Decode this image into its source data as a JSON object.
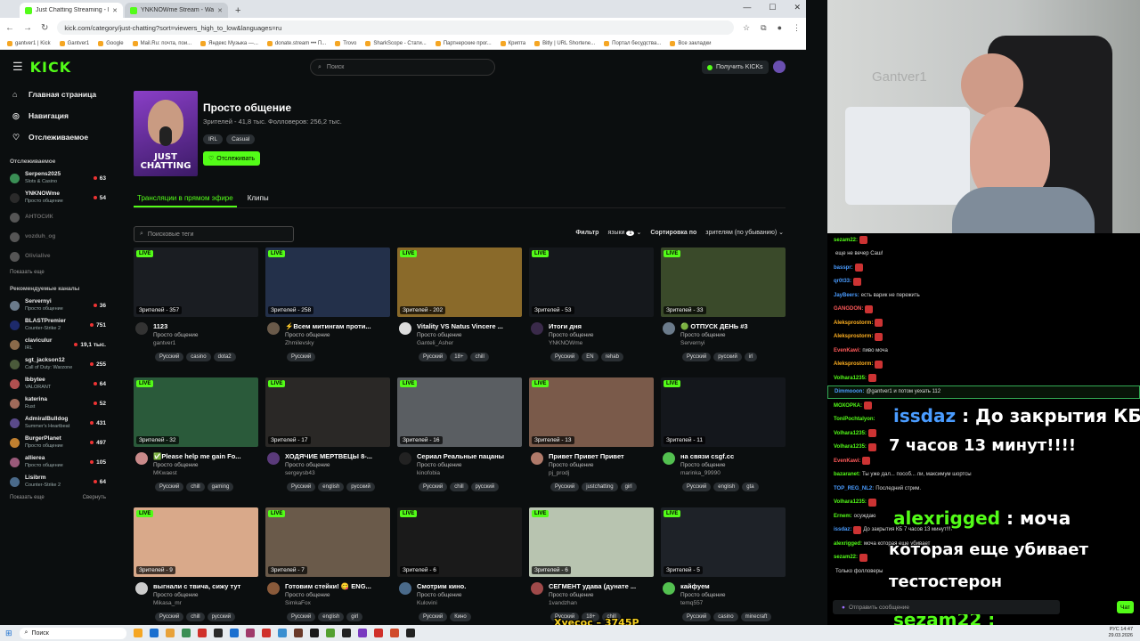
{
  "browser": {
    "tabs": [
      {
        "label": "Just Chatting Streaming - Live"
      },
      {
        "label": "YNKNOWme Stream - Watch Li..."
      }
    ],
    "url": "kick.com/category/just-chatting?sort=viewers_high_to_low&languages=ru",
    "bookmarks": [
      "gantver1 | Kick",
      "Gantver1",
      "Google",
      "Mail.Ru: почта, пои...",
      "Яндекс Музыка —...",
      "donate.stream ••• П...",
      "Trovo",
      "SharkScope - Стати...",
      "Партнерские прог...",
      "Крипта",
      "Bitly | URL Shortene...",
      "Портал бесудства...",
      "Все закладки"
    ]
  },
  "kick": {
    "logo": "KICK",
    "search_placeholder": "Поиск",
    "get_kicks": "Получить KICKs",
    "nav": [
      {
        "label": "Главная страница",
        "icon": "home-icon"
      },
      {
        "label": "Навигация",
        "icon": "compass-icon"
      },
      {
        "label": "Отслеживаемое",
        "icon": "heart-icon"
      }
    ],
    "following_header": "Отслеживаемое",
    "following": [
      {
        "name": "Serpens2025",
        "cat": "Slots & Casino",
        "count": "63",
        "color": "#3a8f55",
        "offline": false
      },
      {
        "name": "YNKNOWme",
        "cat": "Просто общение",
        "count": "54",
        "color": "#2a2a2a",
        "offline": false
      },
      {
        "name": "АНТОСИК",
        "cat": "",
        "count": "",
        "color": "#555",
        "offline": true
      },
      {
        "name": "vozduh_og",
        "cat": "",
        "count": "",
        "color": "#555",
        "offline": true
      },
      {
        "name": "Olivialive",
        "cat": "",
        "count": "",
        "color": "#555",
        "offline": true
      }
    ],
    "show_more": "Показать еще",
    "recommended_header": "Рекомендуемые каналы",
    "recommended": [
      {
        "name": "Servernyi",
        "cat": "Просто общение",
        "count": "36",
        "color": "#6b7b8b"
      },
      {
        "name": "BLASTPremier",
        "cat": "Counter-Strike 2",
        "count": "751",
        "color": "#1d2a6b"
      },
      {
        "name": "claviculur",
        "cat": "IRL",
        "count": "19,1 тыс.",
        "color": "#8a6a4a"
      },
      {
        "name": "sgt_jackson12",
        "cat": "Call of Duty: Warzone",
        "count": "255",
        "color": "#4a5a3a"
      },
      {
        "name": "Ibbytee",
        "cat": "VALORANT",
        "count": "64",
        "color": "#b05050"
      },
      {
        "name": "katerina",
        "cat": "Rust",
        "count": "52",
        "color": "#a06a5a"
      },
      {
        "name": "AdmiralBulldog",
        "cat": "Summer's Heartbeat",
        "count": "431",
        "color": "#5a4a8a"
      },
      {
        "name": "BurgerPlanet",
        "cat": "Просто общение",
        "count": "497",
        "color": "#c08030"
      },
      {
        "name": "allierea",
        "cat": "Просто общение",
        "count": "105",
        "color": "#9a5a7a"
      },
      {
        "name": "Lisibrm",
        "cat": "Counter-Strike 2",
        "count": "64",
        "color": "#4a6a8a"
      }
    ],
    "show_more2": "Показать еще",
    "collapse": "Свернуть",
    "category": {
      "title": "Просто общение",
      "stats": "Зрителей - 41,8 тыс.  Фолловеров: 256,2 тыс.",
      "tags": [
        "IRL",
        "Casual"
      ],
      "follow": "Отслеживать",
      "image_text": "JUST CHATTING"
    },
    "tabs": [
      "Трансляции в прямом эфире",
      "Клипы"
    ],
    "tag_search_placeholder": "Поисковые теги",
    "filter_label": "Фильтр",
    "languages_label": "языки",
    "languages_count": "1",
    "sort_label": "Сортировка по",
    "sort_value": "зрителям (по убыванию)",
    "live_label": "LIVE",
    "streams": [
      {
        "viewers": "Зрителей - 357",
        "title": "1123",
        "cat": "Просто общение",
        "user": "gantver1",
        "tags": [
          "Русский",
          "casino",
          "dota2"
        ],
        "bg": "#1a1d22",
        "av": "#333"
      },
      {
        "viewers": "Зрителей - 258",
        "title": "⚡Всем митингам проти...",
        "cat": "Просто общение",
        "user": "Zhmilevsky",
        "tags": [
          "Русский"
        ],
        "bg": "#23304a",
        "av": "#6a5a4a"
      },
      {
        "viewers": "Зрителей - 202",
        "title": "Vitality VS Natus Vincere ...",
        "cat": "Просто общение",
        "user": "Ganteli_Asher",
        "tags": [
          "Русский",
          "18+",
          "chill"
        ],
        "bg": "#8a6a2a",
        "av": "#ddd"
      },
      {
        "viewers": "Зрителей - 53",
        "title": "Итоги дня",
        "cat": "Просто общение",
        "user": "YNKNOWme",
        "tags": [
          "Русский",
          "EN",
          "rehab"
        ],
        "bg": "#15181c",
        "av": "#3a2a4a"
      },
      {
        "viewers": "Зрителей - 33",
        "title": "🟢 ОТПУСК ДЕНЬ #3",
        "cat": "Просто общение",
        "user": "Servernyi",
        "tags": [
          "Русский",
          "русский",
          "irl"
        ],
        "bg": "#3a4a2a",
        "av": "#6b7b8b"
      },
      {
        "viewers": "Зрителей - 32",
        "title": "✅Please help me gain Fo...",
        "cat": "Просто общение",
        "user": "MKwaest",
        "tags": [
          "Русский",
          "chill",
          "gaming"
        ],
        "bg": "#2a5a3a",
        "av": "#c98a8a"
      },
      {
        "viewers": "Зрителей - 17",
        "title": "ХОДЯЧИЕ МЕРТВЕЦЫ 8-...",
        "cat": "Просто общение",
        "user": "sergeysb43",
        "tags": [
          "Русский",
          "english",
          "русский"
        ],
        "bg": "#2a2826",
        "av": "#5a3a7a"
      },
      {
        "viewers": "Зрителей - 16",
        "title": "Сериал Реальные пацаны",
        "cat": "Просто общение",
        "user": "kinofobia",
        "tags": [
          "Русский",
          "chill",
          "русский"
        ],
        "bg": "#5a5e62",
        "av": "#222"
      },
      {
        "viewers": "Зрителей - 13",
        "title": "Привет Привет Привет",
        "cat": "Просто общение",
        "user": "pj_prodj",
        "tags": [
          "Русский",
          "justchatting",
          "girl"
        ],
        "bg": "#7a5a4a",
        "av": "#b07a6a"
      },
      {
        "viewers": "Зрителей - 11",
        "title": "на связи csgf.cc",
        "cat": "Просто общение",
        "user": "marinka_99990",
        "tags": [
          "Русский",
          "english",
          "gta"
        ],
        "bg": "#14171c",
        "av": "#53c050"
      },
      {
        "viewers": "Зрителей - 9",
        "title": "выгнали с твича, сижу тут",
        "cat": "Просто общение",
        "user": "Mikasa_mr",
        "tags": [
          "Русский",
          "chill",
          "русский"
        ],
        "bg": "#d9a98a",
        "av": "#ccc"
      },
      {
        "viewers": "Зрителей - 7",
        "title": "Готовим стейки! 😋 ENG...",
        "cat": "Просто общение",
        "user": "SimkaFox",
        "tags": [
          "Русский",
          "english",
          "girl"
        ],
        "bg": "#6a5a4a",
        "av": "#8a5a3a"
      },
      {
        "viewers": "Зрителей - 6",
        "title": "Смотрим кино.",
        "cat": "Просто общение",
        "user": "Kulovini",
        "tags": [
          "Русский",
          "Кино"
        ],
        "bg": "#1a1a1a",
        "av": "#4a6a8a"
      },
      {
        "viewers": "Зрителей - 6",
        "title": "СЕГМЕНТ удава (дунате ...",
        "cat": "Просто общение",
        "user": "1vandzhan",
        "tags": [
          "Русский",
          "18+",
          "chill"
        ],
        "bg": "#b8c4b0",
        "av": "#a04a4a"
      },
      {
        "viewers": "Зрителей - 5",
        "title": "кайфуем",
        "cat": "Просто общение",
        "user": "temq557",
        "tags": [
          "Русский",
          "casino",
          "minecraft"
        ],
        "bg": "#1e2228",
        "av": "#53c050"
      }
    ]
  },
  "stream": {
    "watermark": "Gantver1"
  },
  "chat": {
    "messages": [
      {
        "user": "sezam22:",
        "color": "#53fc18",
        "text": "",
        "emote": true
      },
      {
        "user": "",
        "color": "#53fc18",
        "text": "еще не вечер Саш!",
        "emote": false
      },
      {
        "user": "basspr:",
        "color": "#4a9cff",
        "text": "",
        "emote": true
      },
      {
        "user": "qr0t33:",
        "color": "#4a9cff",
        "text": "",
        "emote": true
      },
      {
        "user": "JayBeers:",
        "color": "#4a9cff",
        "text": "есть варик не пережить",
        "emote": false
      },
      {
        "user": "GANGDON:",
        "color": "#ff5a5a",
        "text": "",
        "emote": true
      },
      {
        "user": "Aleksprostorm:",
        "color": "#ffb020",
        "text": "",
        "emote": true
      },
      {
        "user": "Aleksprostorm:",
        "color": "#ffb020",
        "text": "",
        "emote": true
      },
      {
        "user": "EvenKawi:",
        "color": "#ff5a5a",
        "text": "пиво мочa",
        "emote": false
      },
      {
        "user": "Aleksprostorm:",
        "color": "#ffb020",
        "text": "",
        "emote": true
      },
      {
        "user": "Volhara1235:",
        "color": "#53fc18",
        "text": "",
        "emote": true
      },
      {
        "user": "Dimmooon:",
        "color": "#4a9cff",
        "text": "@gantver1 и потом уехать 112",
        "emote": false,
        "hl": true
      },
      {
        "user": "МОХОРКА:",
        "color": "#53fc18",
        "text": "",
        "emote": true
      },
      {
        "user": "ToniPochtalyon:",
        "color": "#53fc18",
        "text": "",
        "emote": false
      },
      {
        "user": "Volhara1235:",
        "color": "#53fc18",
        "text": "",
        "emote": true
      },
      {
        "user": "Volhara1235:",
        "color": "#53fc18",
        "text": "",
        "emote": true
      },
      {
        "user": "EvenKawi:",
        "color": "#ff5a5a",
        "text": "",
        "emote": true
      },
      {
        "user": "bazaranet:",
        "color": "#53fc18",
        "text": "Ты уже дал... пособ... ли, максимум шортсы",
        "emote": false
      },
      {
        "user": "TOP_REG_NL2:",
        "color": "#4a9cff",
        "text": "Последний стрим.",
        "emote": false
      },
      {
        "user": "Volhara1235:",
        "color": "#53fc18",
        "text": "",
        "emote": true
      },
      {
        "user": "Ernem:",
        "color": "#53fc18",
        "text": "осуждаю",
        "emote": false
      },
      {
        "user": "issdaz:",
        "color": "#4a9cff",
        "text": "До закрытия КБ 7 часов 13 минут!!!!",
        "emote": true
      },
      {
        "user": "alexrigged:",
        "color": "#53fc18",
        "text": "моча которая еще убивает",
        "emote": false
      },
      {
        "user": "sezam22:",
        "color": "#53fc18",
        "text": "",
        "emote": true
      },
      {
        "user": "",
        "color": "#999",
        "text": "Только фолловеры",
        "emote": false
      }
    ],
    "input_placeholder": "Отправить сообщение",
    "send": "Чат"
  },
  "overlays": {
    "o1_user": "issdaz",
    "o1_text": " : До закрытия КБ",
    "o1_text2": "7 часов 13 минут!!!!",
    "o2_user": "alexrigged",
    "o2_text": " : моча",
    "o2_text2": "которая еще убивает",
    "o2_text3": "тестостерон",
    "o3_user": "sezam22 :",
    "o4_text": "Хуесос – 3745Р"
  },
  "taskbar": {
    "search": "Поиск",
    "lang": "РУС",
    "time": "14:47",
    "date": "29.03.2026"
  }
}
